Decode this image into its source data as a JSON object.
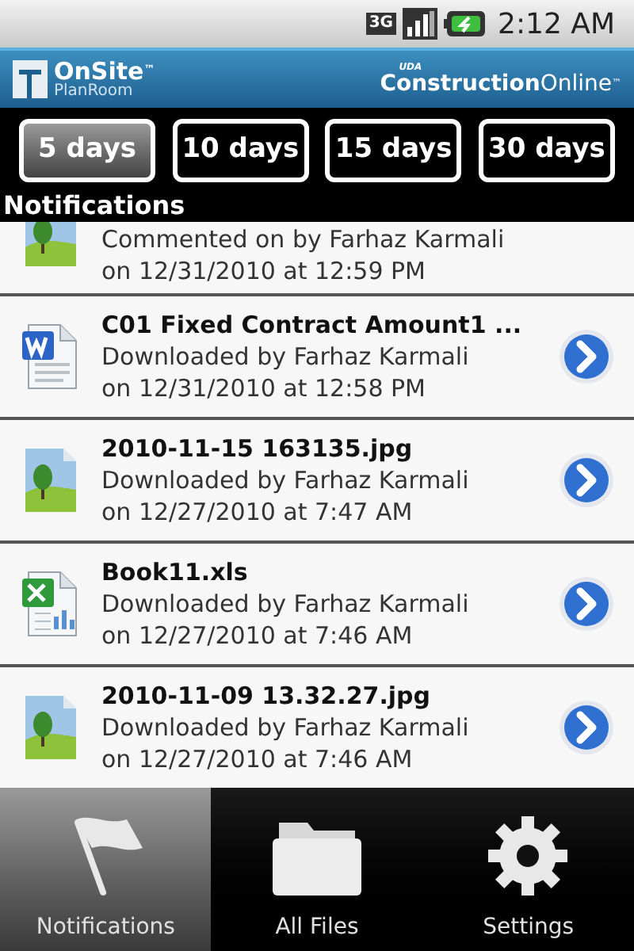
{
  "status_bar": {
    "network": "3G",
    "time": "2:12 AM"
  },
  "header": {
    "left_logo": {
      "title": "OnSite",
      "tm": "™",
      "subtitle": "PlanRoom"
    },
    "right_logo": {
      "small": "UDA",
      "bold": "Construction",
      "light": "Online",
      "tm": "™"
    }
  },
  "tabs": [
    {
      "label": "5 days",
      "selected": true
    },
    {
      "label": "10 days",
      "selected": false
    },
    {
      "label": "15 days",
      "selected": false
    },
    {
      "label": "30 days",
      "selected": false
    }
  ],
  "section_title": "Notifications",
  "items": [
    {
      "kind": "image",
      "line1": "Commented on by Farhaz Karmali",
      "line2": "on 12/31/2010 at 12:59 PM"
    },
    {
      "kind": "word",
      "title": "C01 Fixed Contract Amount1 ...",
      "line1": "Downloaded by Farhaz Karmali",
      "line2": "on 12/31/2010 at 12:58 PM"
    },
    {
      "kind": "image",
      "title": "2010-11-15 163135.jpg",
      "line1": "Downloaded by Farhaz Karmali",
      "line2": "on 12/27/2010 at 7:47 AM"
    },
    {
      "kind": "excel",
      "title": "Book11.xls",
      "line1": "Downloaded by Farhaz Karmali",
      "line2": "on 12/27/2010 at 7:46 AM"
    },
    {
      "kind": "image",
      "title": "2010-11-09 13.32.27.jpg",
      "line1": "Downloaded by Farhaz Karmali",
      "line2": "on 12/27/2010 at 7:46 AM"
    }
  ],
  "bottom_nav": [
    {
      "kind": "flag",
      "label": "Notifications",
      "selected": true
    },
    {
      "kind": "folder",
      "label": "All Files",
      "selected": false
    },
    {
      "kind": "gear",
      "label": "Settings",
      "selected": false
    }
  ]
}
